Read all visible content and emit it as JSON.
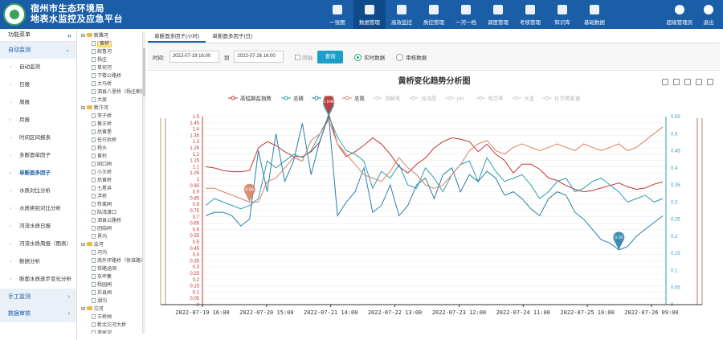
{
  "header": {
    "title_line1": "宿州市生态环境局",
    "title_line2": "地表水监控及应急平台",
    "nav": [
      {
        "label": "一张图",
        "icon": "rocket-icon"
      },
      {
        "label": "数据管理",
        "icon": "database-icon",
        "active": true
      },
      {
        "label": "高效监控",
        "icon": "globe-icon"
      },
      {
        "label": "质控管理",
        "icon": "shield-icon"
      },
      {
        "label": "一河一档",
        "icon": "monitor-icon"
      },
      {
        "label": "调度管理",
        "icon": "calendar-icon"
      },
      {
        "label": "考核管理",
        "icon": "briefcase-icon"
      },
      {
        "label": "知识库",
        "icon": "book-icon"
      },
      {
        "label": "基础数据",
        "icon": "edit-icon"
      }
    ],
    "user": "超级管理员",
    "logout": "退出"
  },
  "sidebar": {
    "title": "功能菜单",
    "groups": [
      {
        "label": "自动监测",
        "items": [
          "自动监测",
          "日报",
          "周报",
          "月报",
          "时间区间报表",
          "多断面单因子",
          "单断面多因子",
          "水质对比分析",
          "水质类别对比分析",
          "河流水质日报",
          "河流水质周报（图表）",
          "数据分析",
          "断面水质逐步变化分析"
        ]
      },
      {
        "label": "手工监测",
        "items": []
      },
      {
        "label": "数据审核",
        "items": []
      }
    ],
    "active_item": "单断面多因子"
  },
  "tree": {
    "groups": [
      {
        "label": "新濉河",
        "nodes": [
          "黄桥",
          "邮鲁河",
          "杨庄",
          "草坝河",
          "下楼公路桥",
          "大马桥",
          "泗县八里桥（杨庄断面）",
          "大居"
        ]
      },
      {
        "label": "新汴河",
        "nodes": [
          "李子桥",
          "蔡王桥",
          "后黄堡",
          "任圩后桥",
          "杨头",
          "黄村",
          "固口闸",
          "小王桥",
          "后黄桥",
          "七星井",
          "浮桥",
          "符离闸",
          "陆湾渡口",
          "泗县公路桥",
          "团结闸",
          "界沟"
        ]
      },
      {
        "label": "浍河",
        "nodes": [
          "河沟",
          "南外环路桥（徐淮路）",
          "铁路涵洞",
          "东坪集",
          "杨园闸",
          "祁县闸",
          "湖沟"
        ]
      },
      {
        "label": "沱河",
        "nodes": [
          "王桥闸",
          "新北沱河大桥",
          "李家河",
          "胡家河"
        ]
      }
    ],
    "selected": "黄桥"
  },
  "tabs": [
    {
      "label": "单断面多因子(小时)",
      "active": true
    },
    {
      "label": "单断面多因子(日)",
      "active": false
    }
  ],
  "filters": {
    "time_label": "时间:",
    "start": "2022-07-19 16:00",
    "to_label": "到",
    "end": "2022-07-26 16:00",
    "network_label": "同轴",
    "query_label": "查询",
    "radio_realtime": "实时数据",
    "radio_audit": "审核数据"
  },
  "colors": {
    "header_bg": "#1a5ea8",
    "cod": "#c23531",
    "tp": "#2f9db5",
    "nh3": "#2a7fa8",
    "tn": "#d48265",
    "disabled": "#cccccc"
  },
  "chart_data": {
    "type": "line",
    "title": "黄桥变化趋势分析图",
    "legend": [
      {
        "name": "高锰酸盐指数",
        "active": true
      },
      {
        "name": "总磷",
        "active": true
      },
      {
        "name": "氨氮",
        "active": true
      },
      {
        "name": "总氮",
        "active": true
      },
      {
        "name": "溶解氧",
        "active": false
      },
      {
        "name": "浊浊度",
        "active": false
      },
      {
        "name": "pH",
        "active": false
      },
      {
        "name": "电导率",
        "active": false
      },
      {
        "name": "水温",
        "active": false
      },
      {
        "name": "化学需氧量",
        "active": false
      }
    ],
    "x_ticks": [
      "2022-07-19 16:00",
      "2022-07-20 15:00",
      "2022-07-21 14:00",
      "2022-07-22 13:00",
      "2022-07-23 12:00",
      "2022-07-24 11:00",
      "2022-07-25 10:00",
      "2022-07-26 09:00"
    ],
    "y_left": {
      "min": 0,
      "max": 1.5,
      "ticks": [
        "0",
        "0.05",
        "0.1",
        "0.15",
        "0.2",
        "0.25",
        "0.3",
        "0.35",
        "0.4",
        "0.45",
        "0.5",
        "0.55",
        "0.6",
        "0.65",
        "0.7",
        "0.75",
        "0.8",
        "0.85",
        "0.9",
        "0.95",
        "1",
        "1.05",
        "1.1",
        "1.15",
        "1.2",
        "1.25",
        "1.3",
        "1.35",
        "1.4",
        "1.45",
        "1.5"
      ]
    },
    "y_right": {
      "min": 0,
      "max": 0.55,
      "ticks": [
        "0",
        "0.05",
        "0.1",
        "0.15",
        "0.2",
        "0.25",
        "0.3",
        "0.35",
        "0.4",
        "0.45",
        "0.5",
        "0.55"
      ]
    },
    "series": [
      {
        "name": "高锰酸盐指数",
        "axis": "left",
        "values": [
          1.1,
          1.09,
          1.07,
          1.06,
          1.06,
          1.07,
          1.25,
          1.3,
          1.27,
          1.22,
          1.18,
          1.18,
          1.22,
          1.3,
          1.52,
          1.28,
          1.18,
          1.22,
          1.27,
          1.33,
          1.28,
          1.2,
          1.1,
          1.05,
          1.12,
          1.17,
          1.25,
          1.3,
          1.33,
          1.32,
          1.3,
          1.22,
          1.28,
          1.2,
          1.15,
          1.05,
          1.12,
          1.12,
          1.08,
          1.01,
          0.99,
          0.95,
          0.92,
          0.9,
          0.91,
          0.93,
          0.95,
          0.97,
          0.94,
          0.92,
          0.93,
          0.96,
          0.98
        ]
      },
      {
        "name": "总磷",
        "axis": "right",
        "values": [
          0.29,
          0.31,
          0.3,
          0.29,
          0.28,
          0.29,
          0.31,
          0.42,
          0.4,
          0.42,
          0.44,
          0.43,
          0.45,
          0.5,
          0.55,
          0.49,
          0.45,
          0.44,
          0.42,
          0.34,
          0.39,
          0.37,
          0.41,
          0.35,
          0.34,
          0.4,
          0.37,
          0.33,
          0.38,
          0.41,
          0.42,
          0.36,
          0.43,
          0.39,
          0.36,
          0.37,
          0.38,
          0.35,
          0.31,
          0.33,
          0.36,
          0.37,
          0.33,
          0.34,
          0.36,
          0.37,
          0.35,
          0.33,
          0.3,
          0.31,
          0.32,
          0.3,
          0.31
        ]
      },
      {
        "name": "氨氮",
        "axis": "right",
        "values": [
          0.26,
          0.27,
          0.27,
          0.26,
          0.23,
          0.25,
          0.45,
          0.33,
          0.5,
          0.36,
          0.42,
          0.53,
          0.38,
          0.48,
          0.55,
          0.26,
          0.3,
          0.33,
          0.4,
          0.27,
          0.29,
          0.35,
          0.26,
          0.29,
          0.35,
          0.37,
          0.31,
          0.38,
          0.4,
          0.33,
          0.38,
          0.36,
          0.39,
          0.37,
          0.32,
          0.33,
          0.31,
          0.28,
          0.26,
          0.31,
          0.33,
          0.32,
          0.27,
          0.25,
          0.22,
          0.19,
          0.18,
          0.16,
          0.17,
          0.2,
          0.22,
          0.24,
          0.26
        ]
      },
      {
        "name": "总氮",
        "axis": "right",
        "values": [
          0.34,
          0.34,
          0.33,
          0.32,
          0.31,
          0.3,
          0.3,
          0.36,
          0.37,
          0.4,
          0.43,
          0.42,
          0.48,
          0.5,
          0.54,
          0.47,
          0.44,
          0.41,
          0.38,
          0.37,
          0.36,
          0.39,
          0.43,
          0.4,
          0.38,
          0.35,
          0.34,
          0.35,
          0.38,
          0.41,
          0.45,
          0.47,
          0.48,
          0.45,
          0.44,
          0.46,
          0.47,
          0.46,
          0.45,
          0.46,
          0.47,
          0.46,
          0.45,
          0.47,
          0.46,
          0.45,
          0.46,
          0.47,
          0.45,
          0.46,
          0.48,
          0.5,
          0.52
        ]
      }
    ],
    "markers": [
      {
        "series": "总磷",
        "label": "1.473"
      },
      {
        "series": "高锰酸盐指数",
        "label": "1.548"
      },
      {
        "series": "氨氮",
        "label": "0.30"
      },
      {
        "series": "总氮",
        "label": "0.96"
      }
    ],
    "grid": true
  }
}
